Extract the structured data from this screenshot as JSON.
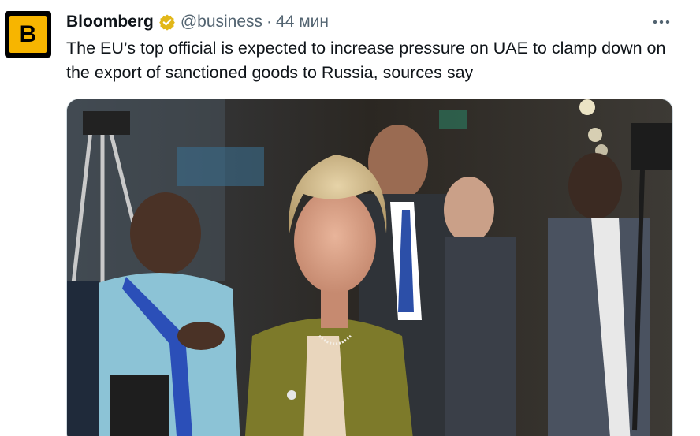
{
  "author": {
    "name": "Bloomberg",
    "handle": "@business",
    "separator": "·",
    "time": "44 мин",
    "verified": true,
    "avatar_letter": "B",
    "avatar_colors": {
      "outer": "#000000",
      "inner": "#f7b500"
    },
    "verified_badge_color": "#e2b719"
  },
  "more_icon": "more-horizontal-icon",
  "tweet_text": "The EU’s top official is expected to increase pressure on UAE to clamp down on the export of sanctioned goods to Russia, sources say",
  "media": {
    "kind": "photo"
  },
  "colors": {
    "text_primary": "#0f1419",
    "text_secondary": "#536471",
    "border": "#cfd9de"
  }
}
